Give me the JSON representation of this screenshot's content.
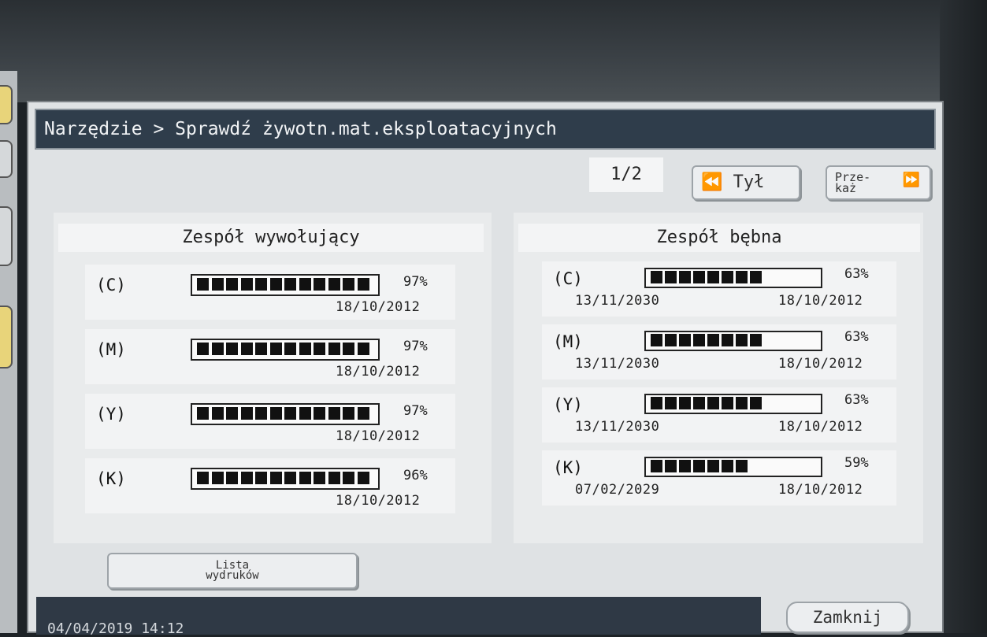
{
  "breadcrumb": "Narzędzie > Sprawdź żywotn.mat.eksploatacyjnych",
  "pager": {
    "indicator": "1/2",
    "back_icon": "double-left-arrow-icon",
    "back_label": "Tył",
    "forward_label_line1": "Prze-",
    "forward_label_line2": "każ",
    "forward_icon": "double-right-arrow-icon"
  },
  "developing": {
    "title": "Zespół wywołujący",
    "items": [
      {
        "label": "(C)",
        "percent": "97%",
        "level": 0.97,
        "date": "18/10/2012"
      },
      {
        "label": "(M)",
        "percent": "97%",
        "level": 0.97,
        "date": "18/10/2012"
      },
      {
        "label": "(Y)",
        "percent": "97%",
        "level": 0.97,
        "date": "18/10/2012"
      },
      {
        "label": "(K)",
        "percent": "96%",
        "level": 0.96,
        "date": "18/10/2012"
      }
    ]
  },
  "drum": {
    "title": "Zespół bębna",
    "items": [
      {
        "label": "(C)",
        "percent": "63%",
        "level": 0.63,
        "date_start": "13/11/2030",
        "date": "18/10/2012"
      },
      {
        "label": "(M)",
        "percent": "63%",
        "level": 0.63,
        "date_start": "13/11/2030",
        "date": "18/10/2012"
      },
      {
        "label": "(Y)",
        "percent": "63%",
        "level": 0.63,
        "date_start": "13/11/2030",
        "date": "18/10/2012"
      },
      {
        "label": "(K)",
        "percent": "59%",
        "level": 0.59,
        "date_start": "07/02/2029",
        "date": "18/10/2012"
      }
    ]
  },
  "footer": {
    "list_label_line1": "Lista",
    "list_label_line2": "wydruków",
    "status_text": "04/04/2019   14:12",
    "close_label": "Zamknij"
  }
}
